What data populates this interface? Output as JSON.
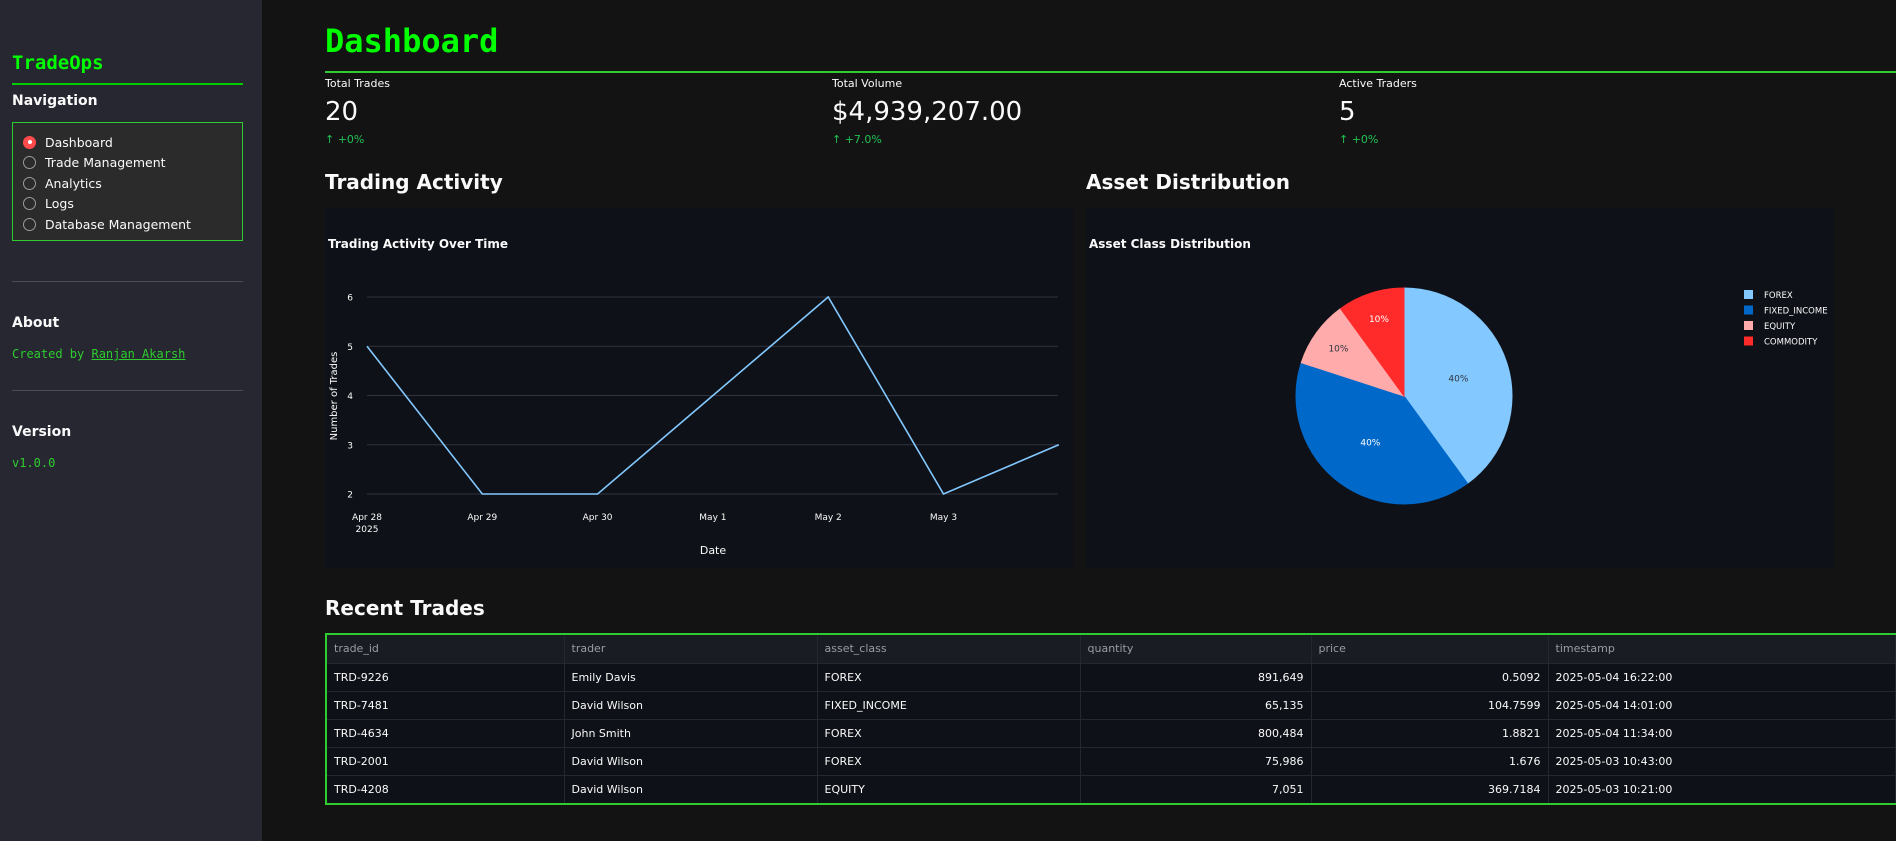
{
  "sidebar": {
    "brand": "TradeOps",
    "nav_heading": "Navigation",
    "nav_items": [
      {
        "label": "Dashboard",
        "selected": true
      },
      {
        "label": "Trade Management",
        "selected": false
      },
      {
        "label": "Analytics",
        "selected": false
      },
      {
        "label": "Logs",
        "selected": false
      },
      {
        "label": "Database Management",
        "selected": false
      }
    ],
    "about_heading": "About",
    "about_prefix": "Created by",
    "about_link": "Ranjan Akarsh",
    "version_heading": "Version",
    "version": "v1.0.0"
  },
  "page_title": "Dashboard",
  "metrics": [
    {
      "label": "Total Trades",
      "value": "20",
      "delta": "+0%"
    },
    {
      "label": "Total Volume",
      "value": "$4,939,207.00",
      "delta": "+7.0%"
    },
    {
      "label": "Active Traders",
      "value": "5",
      "delta": "+0%"
    }
  ],
  "sections": {
    "activity": "Trading Activity",
    "distribution": "Asset Distribution",
    "recent": "Recent Trades"
  },
  "chart_data": [
    {
      "type": "line",
      "title": "Trading Activity Over Time",
      "xlabel": "Date",
      "ylabel": "Number of Trades",
      "x": [
        "2025-04-28",
        "2025-04-29",
        "2025-04-30",
        "2025-05-01",
        "2025-05-02",
        "2025-05-03",
        "2025-05-04"
      ],
      "x_tick_labels": [
        "Apr 28\n2025",
        "Apr 29",
        "Apr 30",
        "May 1",
        "May 2",
        "May 3"
      ],
      "y_ticks": [
        2,
        3,
        4,
        5,
        6
      ],
      "values": [
        5,
        2,
        2,
        4,
        6,
        2,
        3
      ],
      "ylim": [
        2,
        6
      ],
      "color": "#83c9ff",
      "grid": true
    },
    {
      "type": "pie",
      "title": "Asset Class Distribution",
      "legend_position": "top-right",
      "slices": [
        {
          "label": "FOREX",
          "value": 40,
          "text": "40%",
          "color": "#83c9ff"
        },
        {
          "label": "FIXED_INCOME",
          "value": 40,
          "text": "40%",
          "color": "#0068c9"
        },
        {
          "label": "EQUITY",
          "value": 10,
          "text": "10%",
          "color": "#ffabab"
        },
        {
          "label": "COMMODITY",
          "value": 10,
          "text": "10%",
          "color": "#ff2b2b"
        }
      ]
    }
  ],
  "table": {
    "columns": [
      "trade_id",
      "trader",
      "asset_class",
      "quantity",
      "price",
      "timestamp"
    ],
    "rows": [
      [
        "TRD-9226",
        "Emily Davis",
        "FOREX",
        "891,649",
        "0.5092",
        "2025-05-04 16:22:00"
      ],
      [
        "TRD-7481",
        "David Wilson",
        "FIXED_INCOME",
        "65,135",
        "104.7599",
        "2025-05-04 14:01:00"
      ],
      [
        "TRD-4634",
        "John Smith",
        "FOREX",
        "800,484",
        "1.8821",
        "2025-05-04 11:34:00"
      ],
      [
        "TRD-2001",
        "David Wilson",
        "FOREX",
        "75,986",
        "1.676",
        "2025-05-03 10:43:00"
      ],
      [
        "TRD-4208",
        "David Wilson",
        "EQUITY",
        "7,051",
        "369.7184",
        "2025-05-03 10:21:00"
      ]
    ]
  }
}
